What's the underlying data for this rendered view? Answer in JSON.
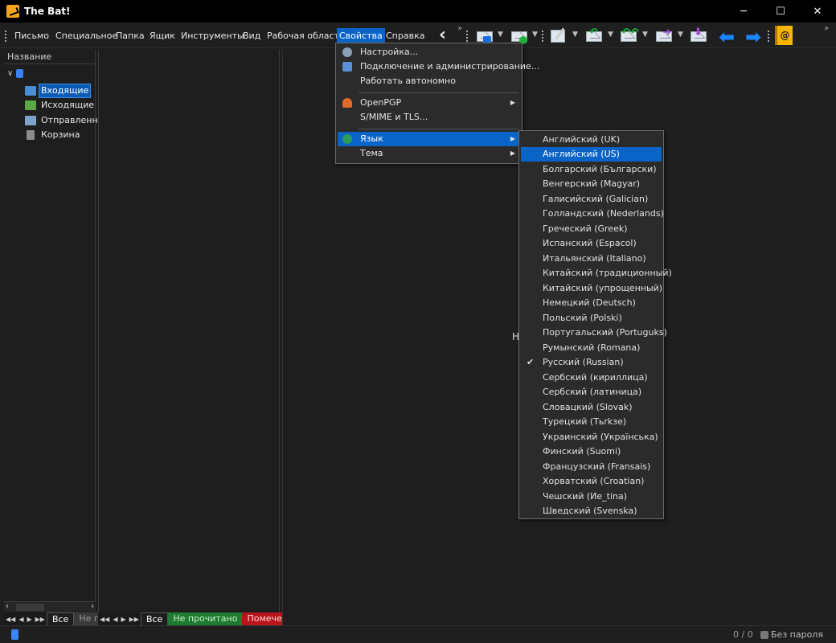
{
  "app": {
    "title": "The Bat!"
  },
  "window_controls": {
    "minimize": "─",
    "maximize": "☐",
    "close": "✕"
  },
  "menu": [
    "Письмо",
    "Специальное",
    "Папка",
    "Ящик",
    "Инструменты",
    "Вид",
    "Рабочая область",
    "Свойства",
    "Справка"
  ],
  "menu_active": "Свойства",
  "toolbar": {
    "overflow": "»"
  },
  "folders": {
    "header": "Название",
    "items": [
      "Входящие",
      "Исходящие",
      "Отправленные",
      "Корзина"
    ],
    "selected": "Входящие"
  },
  "folder_tabs": {
    "all": "Все",
    "unread": "Не п"
  },
  "message_tabs": {
    "all": "Все",
    "unread": "Не прочитано",
    "flagged": "Помече"
  },
  "view": {
    "placeholder": "Н"
  },
  "status": {
    "count": "0 / 0",
    "password": "Без пароля"
  },
  "properties_menu": {
    "items": [
      "Настройка...",
      "Подключение и администрирование...",
      "Работать автономно",
      "OpenPGP",
      "S/MIME и TLS...",
      "Язык",
      "Тема"
    ],
    "highlighted": "Язык"
  },
  "language_menu": {
    "items": [
      "Английский (UK)",
      "Английский (US)",
      "Болгарский (Български)",
      "Венгерский (Magyar)",
      "Галисийский (Galician)",
      "Голландский (Nederlands)",
      "Греческий (Greek)",
      "Испанский (Espacol)",
      "Итальянский (Italiano)",
      "Китайский (традиционный)",
      "Китайский (упрощенный)",
      "Немецкий (Deutsch)",
      "Польский (Polski)",
      "Португальский (Portuguks)",
      "Румынский (Romana)",
      "Русский (Russian)",
      "Сербский (кириллица)",
      "Сербский (латиница)",
      "Словацкий (Slovak)",
      "Турецкий (Tьrkзe)",
      "Украинский (Українська)",
      "Финский (Suomi)",
      "Французский (Fransais)",
      "Хорватский (Croatian)",
      "Чешский (Иe_tina)",
      "Шведский (Svenska)"
    ],
    "highlighted": "Английский (US)",
    "checked": "Русский (Russian)"
  },
  "colors": {
    "accent": "#0a64c8",
    "unread_tab": "#1f7a32",
    "flag_tab": "#b8141c"
  }
}
